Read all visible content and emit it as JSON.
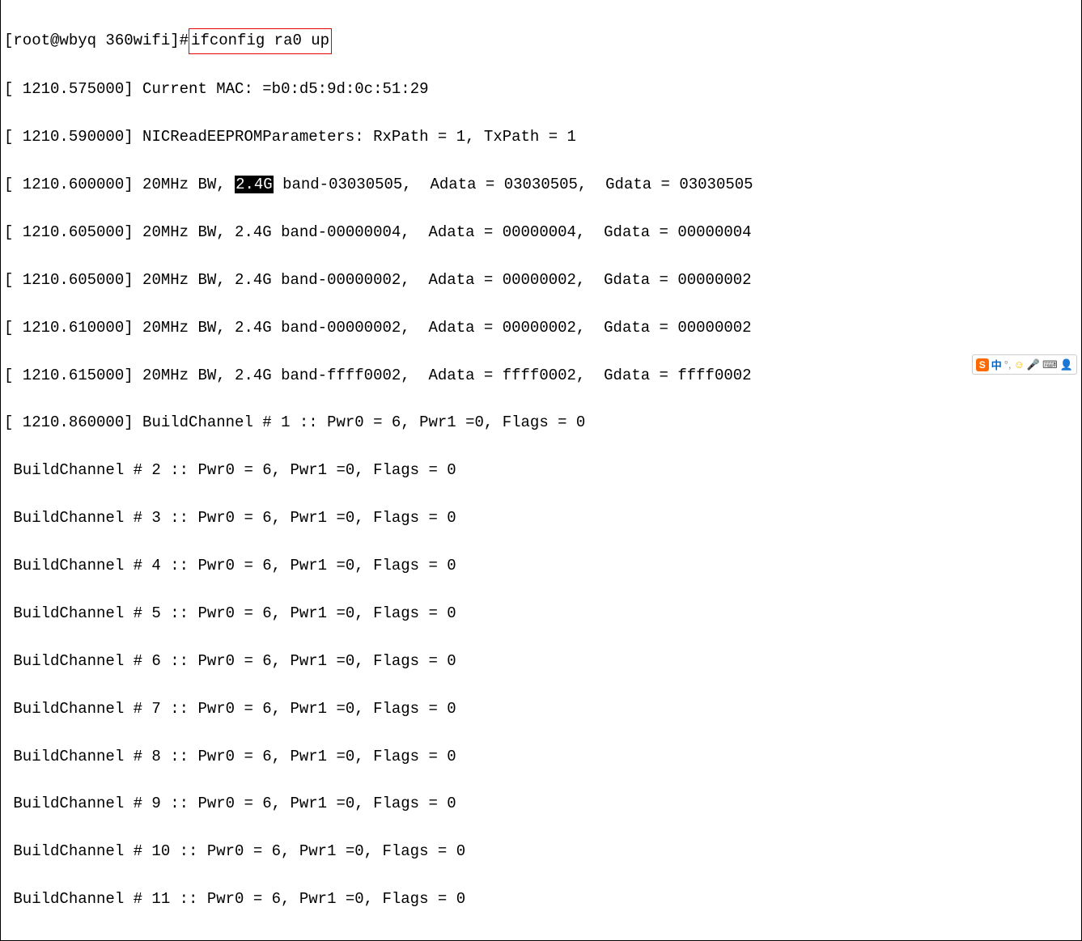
{
  "prompt": "[root@wbyq 360wifi]#",
  "command": "ifconfig ra0 up",
  "lines": [
    {
      "ts": "[ 1210.575000]",
      "rest": " Current MAC: =b0:d5:9d:0c:51:29"
    },
    {
      "ts": "[ 1210.590000]",
      "rest": " NICReadEEPROMParameters: RxPath = 1, TxPath = 1"
    },
    {
      "ts": "[ 1210.600000]",
      "mid_pre": " 20MHz BW, ",
      "hl": "2.4G",
      "mid_post": " band-03030505,  Adata = 03030505,  Gdata = 03030505"
    },
    {
      "ts": "[ 1210.605000]",
      "rest": " 20MHz BW, 2.4G band-00000004,  Adata = 00000004,  Gdata = 00000004"
    },
    {
      "ts": "[ 1210.605000]",
      "rest": " 20MHz BW, 2.4G band-00000002,  Adata = 00000002,  Gdata = 00000002"
    },
    {
      "ts": "[ 1210.610000]",
      "rest": " 20MHz BW, 2.4G band-00000002,  Adata = 00000002,  Gdata = 00000002"
    },
    {
      "ts": "[ 1210.615000]",
      "rest": " 20MHz BW, 2.4G band-ffff0002,  Adata = ffff0002,  Gdata = ffff0002"
    },
    {
      "ts": "[ 1210.860000]",
      "rest": " BuildChannel # 1 :: Pwr0 = 6, Pwr1 =0, Flags = 0 "
    }
  ],
  "build_channels": [
    " BuildChannel # 2 :: Pwr0 = 6, Pwr1 =0, Flags = 0 ",
    " BuildChannel # 3 :: Pwr0 = 6, Pwr1 =0, Flags = 0 ",
    " BuildChannel # 4 :: Pwr0 = 6, Pwr1 =0, Flags = 0 ",
    " BuildChannel # 5 :: Pwr0 = 6, Pwr1 =0, Flags = 0 ",
    " BuildChannel # 6 :: Pwr0 = 6, Pwr1 =0, Flags = 0 ",
    " BuildChannel # 7 :: Pwr0 = 6, Pwr1 =0, Flags = 0 ",
    " BuildChannel # 8 :: Pwr0 = 6, Pwr1 =0, Flags = 0 ",
    " BuildChannel # 9 :: Pwr0 = 6, Pwr1 =0, Flags = 0 ",
    " BuildChannel # 10 :: Pwr0 = 6, Pwr1 =0, Flags = 0 ",
    " BuildChannel # 11 :: Pwr0 = 6, Pwr1 =0, Flags = 0 "
  ],
  "ime": {
    "logo": "S",
    "lang": "中",
    "emoji": "☺",
    "mic": "🎤",
    "keyboard": "⌨",
    "face": "👤"
  }
}
